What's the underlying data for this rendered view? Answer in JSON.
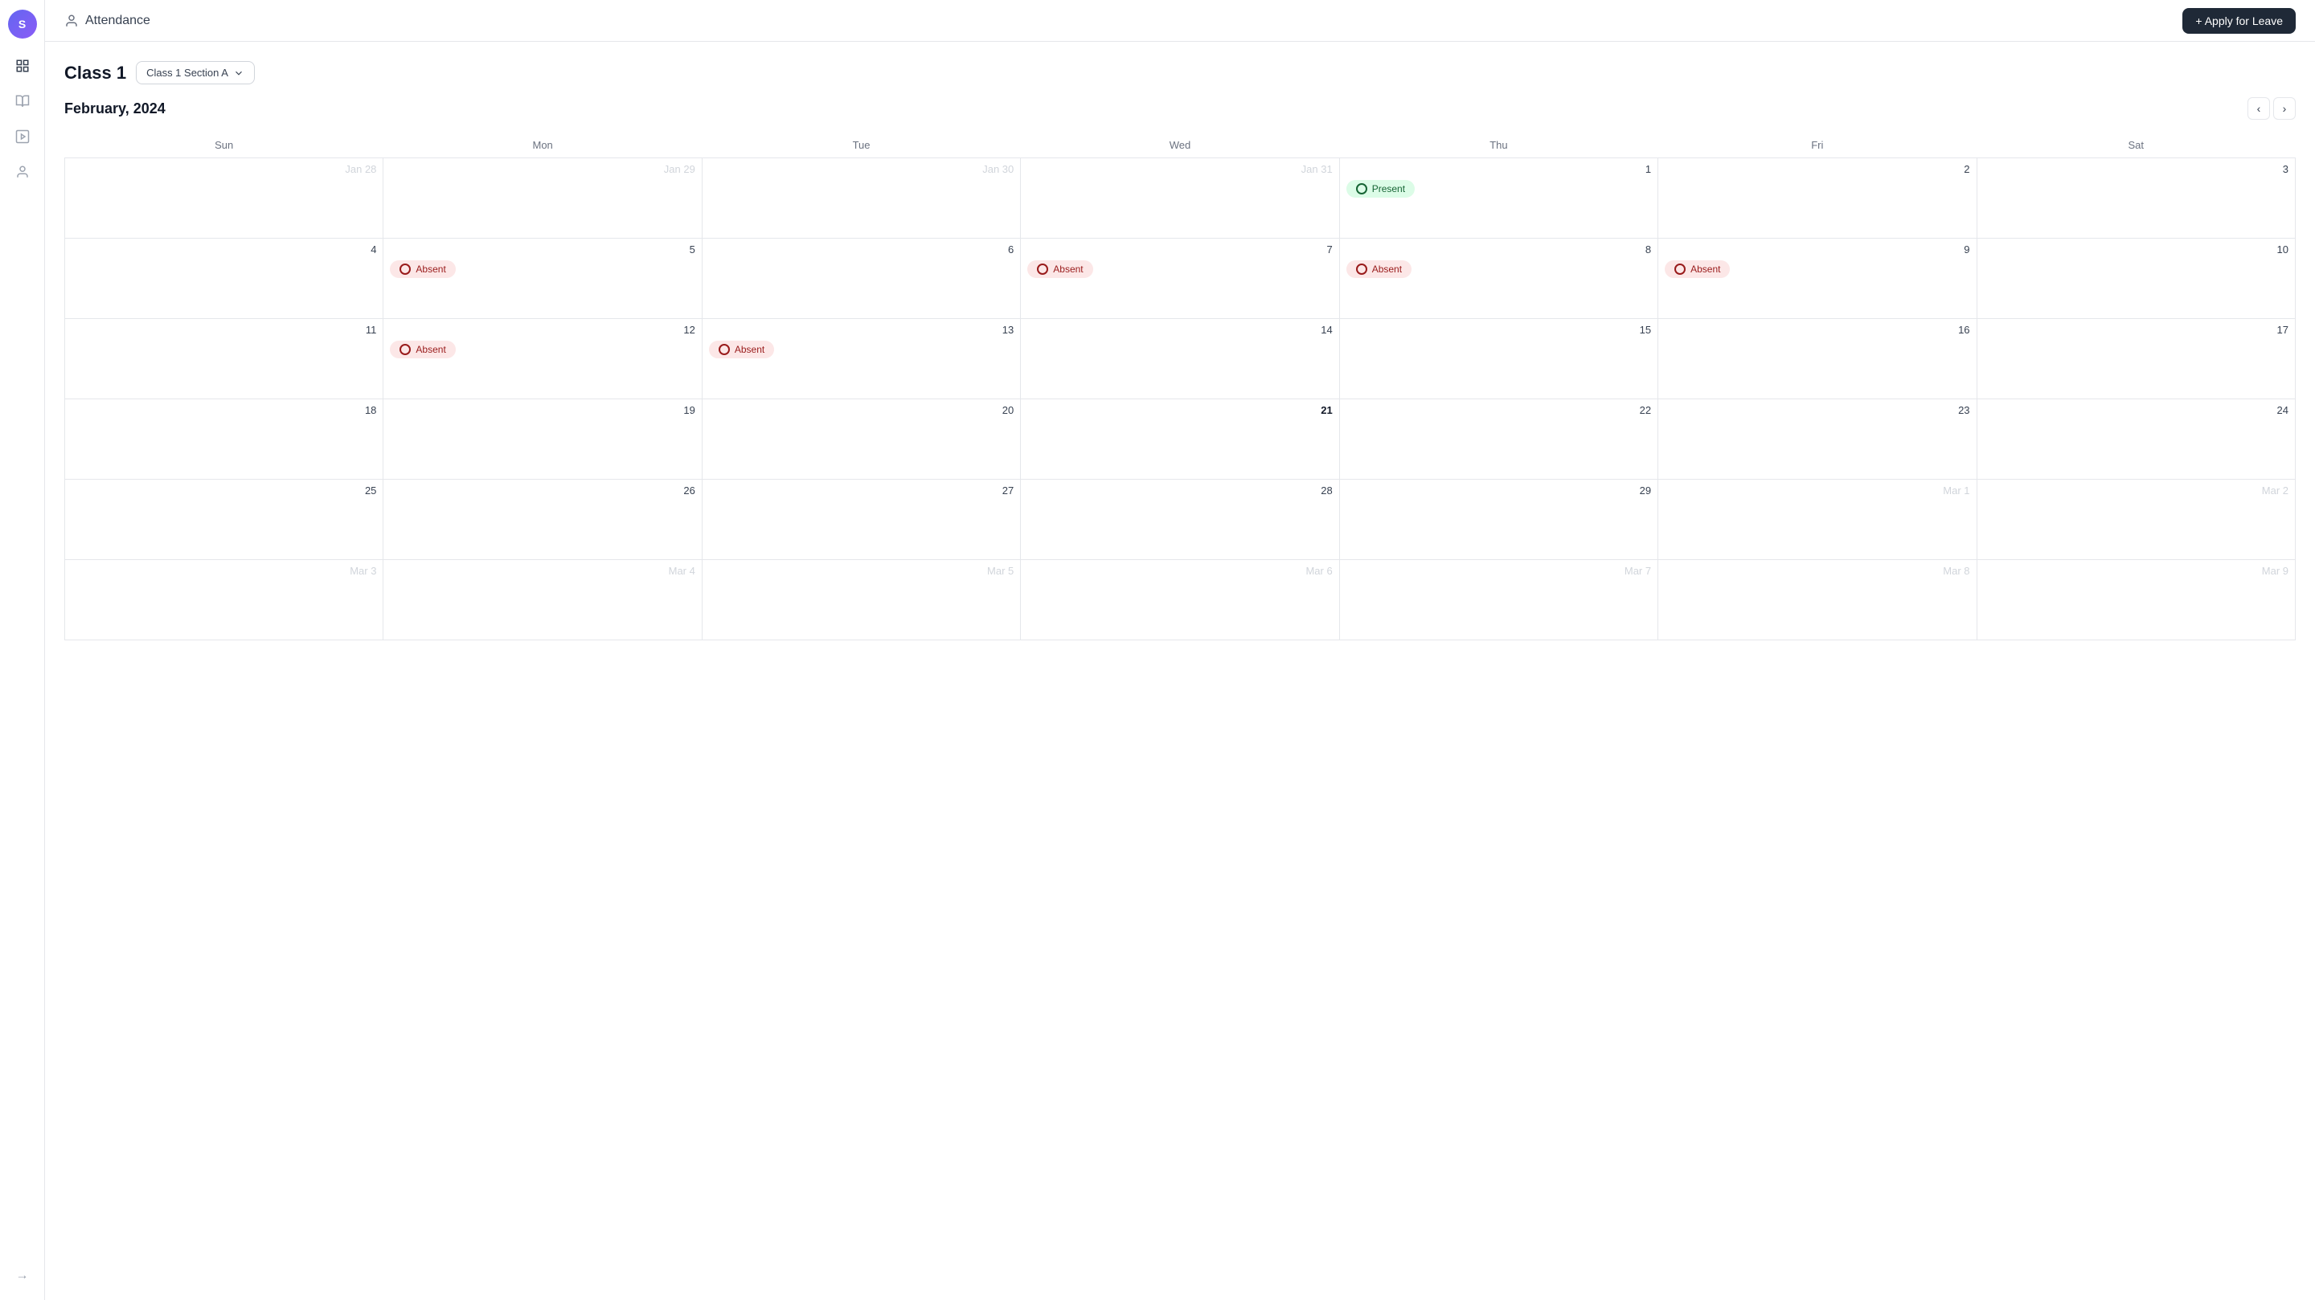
{
  "app": {
    "logo_text": "S",
    "page_title": "Attendance"
  },
  "header": {
    "apply_btn_label": "+ Apply for Leave",
    "person_icon": "👤"
  },
  "class_section": {
    "class_label": "Class 1",
    "section_label": "Class 1 Section A"
  },
  "calendar": {
    "month_title": "February, 2024",
    "days_of_week": [
      "Sun",
      "Mon",
      "Tue",
      "Wed",
      "Thu",
      "Fri",
      "Sat"
    ],
    "weeks": [
      [
        {
          "label": "Jan 28",
          "type": "prev"
        },
        {
          "label": "Jan 29",
          "type": "prev"
        },
        {
          "label": "Jan 30",
          "type": "prev"
        },
        {
          "label": "Jan 31",
          "type": "prev"
        },
        {
          "label": "1",
          "type": "current",
          "attendance": "present"
        },
        {
          "label": "2",
          "type": "current"
        },
        {
          "label": "3",
          "type": "current"
        }
      ],
      [
        {
          "label": "4",
          "type": "current"
        },
        {
          "label": "5",
          "type": "current",
          "attendance": "absent"
        },
        {
          "label": "6",
          "type": "current"
        },
        {
          "label": "7",
          "type": "current",
          "attendance": "absent"
        },
        {
          "label": "8",
          "type": "current",
          "attendance": "absent"
        },
        {
          "label": "9",
          "type": "current",
          "attendance": "absent"
        },
        {
          "label": "10",
          "type": "current"
        }
      ],
      [
        {
          "label": "11",
          "type": "current"
        },
        {
          "label": "12",
          "type": "current",
          "attendance": "absent"
        },
        {
          "label": "13",
          "type": "current",
          "attendance": "absent"
        },
        {
          "label": "14",
          "type": "current"
        },
        {
          "label": "15",
          "type": "current"
        },
        {
          "label": "16",
          "type": "current"
        },
        {
          "label": "17",
          "type": "current"
        }
      ],
      [
        {
          "label": "18",
          "type": "current"
        },
        {
          "label": "19",
          "type": "current"
        },
        {
          "label": "20",
          "type": "current"
        },
        {
          "label": "21",
          "type": "current",
          "today": true
        },
        {
          "label": "22",
          "type": "current"
        },
        {
          "label": "23",
          "type": "current"
        },
        {
          "label": "24",
          "type": "current"
        }
      ],
      [
        {
          "label": "25",
          "type": "current"
        },
        {
          "label": "26",
          "type": "current"
        },
        {
          "label": "27",
          "type": "current"
        },
        {
          "label": "28",
          "type": "current"
        },
        {
          "label": "29",
          "type": "current"
        },
        {
          "label": "Mar 1",
          "type": "next"
        },
        {
          "label": "Mar 2",
          "type": "next"
        }
      ],
      [
        {
          "label": "Mar 3",
          "type": "next"
        },
        {
          "label": "Mar 4",
          "type": "next"
        },
        {
          "label": "Mar 5",
          "type": "next"
        },
        {
          "label": "Mar 6",
          "type": "next"
        },
        {
          "label": "Mar 7",
          "type": "next"
        },
        {
          "label": "Mar 8",
          "type": "next"
        },
        {
          "label": "Mar 9",
          "type": "next"
        }
      ]
    ],
    "badge_present": "Present",
    "badge_absent": "Absent"
  },
  "sidebar": {
    "items": [
      {
        "name": "dashboard",
        "icon": "⊞"
      },
      {
        "name": "courses",
        "icon": "◫"
      },
      {
        "name": "media",
        "icon": "▣"
      },
      {
        "name": "users",
        "icon": "👤"
      }
    ]
  }
}
